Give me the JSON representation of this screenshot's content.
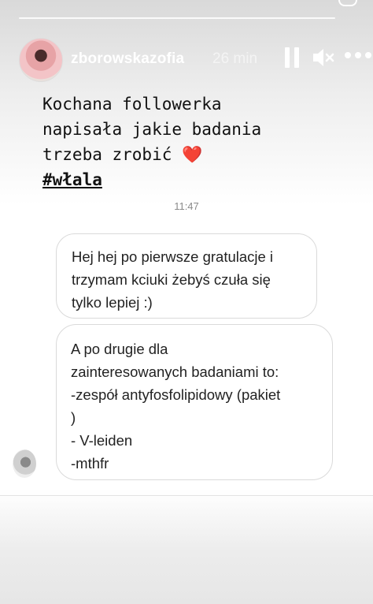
{
  "header": {
    "username": "zborowskazofia",
    "time_ago": "26 min",
    "icons": [
      "pause-icon",
      "mute-icon",
      "more-icon"
    ]
  },
  "caption": {
    "line1": "Kochana followerka",
    "line2": "napisała jakie badania",
    "line3": "trzeba zrobić",
    "heart": "❤️",
    "hashtag": "#włala"
  },
  "chat": {
    "timestamp": "11:47",
    "messages": [
      {
        "lines": [
          "Hej hej po pierwsze gratulacje i",
          "trzymam kciuki żebyś czuła się",
          "tylko lepiej :)"
        ]
      },
      {
        "lines": [
          "A po drugie dla",
          "zainteresowanych badaniami to:",
          "-zespół antyfosfolipidowy (pakiet",
          ")",
          "- V-leiden",
          "-mthfr"
        ]
      }
    ]
  },
  "colors": {
    "heart": "#e0202a",
    "text": "#111111",
    "timestamp": "#8a8a8a"
  }
}
